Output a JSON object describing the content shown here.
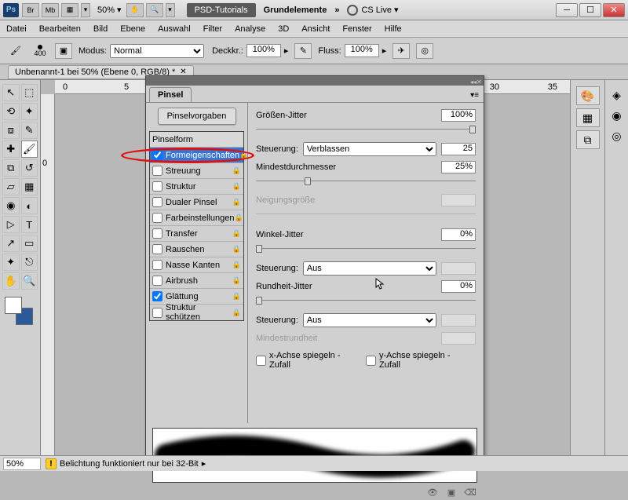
{
  "title_bar": {
    "ps": "Ps",
    "br": "Br",
    "mb": "Mb",
    "zoom": "50%",
    "psd_tutorials": "PSD-Tutorials",
    "grundelemente": "Grundelemente",
    "cslive": "CS Live"
  },
  "menu": [
    "Datei",
    "Bearbeiten",
    "Bild",
    "Ebene",
    "Auswahl",
    "Filter",
    "Analyse",
    "3D",
    "Ansicht",
    "Fenster",
    "Hilfe"
  ],
  "options": {
    "brush_size": "400",
    "modus_lbl": "Modus:",
    "modus_val": "Normal",
    "deckkr_lbl": "Deckkr.:",
    "deckkr_val": "100%",
    "fluss_lbl": "Fluss:",
    "fluss_val": "100%"
  },
  "doc_tab": "Unbenannt-1 bei 50% (Ebene 0, RGB/8) *",
  "ruler_marks_h": [
    "0",
    "5",
    "30",
    "35"
  ],
  "ruler_marks_v": [
    "0"
  ],
  "pinsel": {
    "tab": "Pinsel",
    "preset_btn": "Pinselvorgaben",
    "cats": [
      {
        "label": "Pinselform",
        "chk": null,
        "lock": false,
        "hdr": true,
        "sel": false
      },
      {
        "label": "Formeigenschaften",
        "chk": true,
        "lock": true,
        "hdr": false,
        "sel": true
      },
      {
        "label": "Streuung",
        "chk": false,
        "lock": true,
        "hdr": false,
        "sel": false
      },
      {
        "label": "Struktur",
        "chk": false,
        "lock": true,
        "hdr": false,
        "sel": false
      },
      {
        "label": "Dualer Pinsel",
        "chk": false,
        "lock": true,
        "hdr": false,
        "sel": false
      },
      {
        "label": "Farbeinstellungen",
        "chk": false,
        "lock": true,
        "hdr": false,
        "sel": false
      },
      {
        "label": "Transfer",
        "chk": false,
        "lock": true,
        "hdr": false,
        "sel": false
      },
      {
        "label": "Rauschen",
        "chk": false,
        "lock": true,
        "hdr": false,
        "sel": false
      },
      {
        "label": "Nasse Kanten",
        "chk": false,
        "lock": true,
        "hdr": false,
        "sel": false
      },
      {
        "label": "Airbrush",
        "chk": false,
        "lock": true,
        "hdr": false,
        "sel": false
      },
      {
        "label": "Glättung",
        "chk": true,
        "lock": true,
        "hdr": false,
        "sel": false
      },
      {
        "label": "Struktur schützen",
        "chk": false,
        "lock": true,
        "hdr": false,
        "sel": false
      }
    ],
    "right": {
      "groessen_jitter": "Größen-Jitter",
      "groessen_jitter_val": "100%",
      "steuerung": "Steuerung:",
      "steuerung1_val": "Verblassen",
      "steuerung1_num": "25",
      "mindest": "Mindestdurchmesser",
      "mindest_val": "25%",
      "neigung": "Neigungsgröße",
      "winkel_jitter": "Winkel-Jitter",
      "winkel_jitter_val": "0%",
      "steuerung2_val": "Aus",
      "rundheit_jitter": "Rundheit-Jitter",
      "rundheit_jitter_val": "0%",
      "steuerung3_val": "Aus",
      "mindestrund": "Mindestrundheit",
      "x_flip": "x-Achse spiegeln - Zufall",
      "y_flip": "y-Achse spiegeln - Zufall"
    }
  },
  "status": {
    "zoom": "50%",
    "msg": "Belichtung funktioniert nur bei 32-Bit"
  }
}
